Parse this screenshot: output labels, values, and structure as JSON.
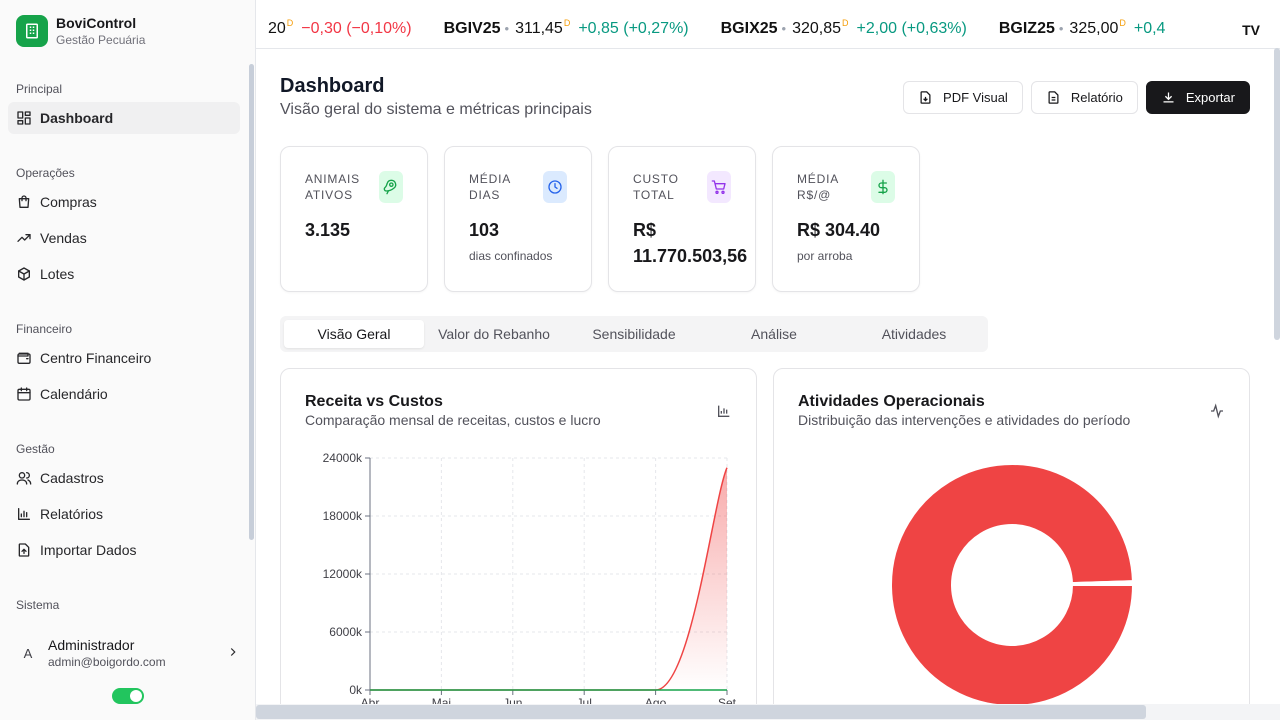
{
  "brand": {
    "name": "BoviControl",
    "subtitle": "Gestão Pecuária"
  },
  "sidebar": {
    "groups": [
      {
        "label": "Principal",
        "items": [
          {
            "label": "Dashboard",
            "icon": "dashboard-icon",
            "active": true
          }
        ]
      },
      {
        "label": "Operações",
        "items": [
          {
            "label": "Compras",
            "icon": "shopping-bag-icon"
          },
          {
            "label": "Vendas",
            "icon": "trending-up-icon"
          },
          {
            "label": "Lotes",
            "icon": "package-icon"
          }
        ]
      },
      {
        "label": "Financeiro",
        "items": [
          {
            "label": "Centro Financeiro",
            "icon": "wallet-icon"
          },
          {
            "label": "Calendário",
            "icon": "calendar-icon"
          }
        ]
      },
      {
        "label": "Gestão",
        "items": [
          {
            "label": "Cadastros",
            "icon": "users-icon"
          },
          {
            "label": "Relatórios",
            "icon": "bar-chart-icon"
          },
          {
            "label": "Importar Dados",
            "icon": "file-upload-icon"
          }
        ]
      },
      {
        "label": "Sistema",
        "items": []
      }
    ],
    "user": {
      "initial": "A",
      "name": "Administrador",
      "email": "admin@boigordo.com"
    }
  },
  "ticker": {
    "items": [
      {
        "symbol": "",
        "price": "20",
        "sup": "D",
        "change": "−0,30 (−0,10%)",
        "trend": "neg"
      },
      {
        "symbol": "BGIV25",
        "price": "311,45",
        "sup": "D",
        "change": "+0,85 (+0,27%)",
        "trend": "pos"
      },
      {
        "symbol": "BGIX25",
        "price": "320,85",
        "sup": "D",
        "change": "+2,00 (+0,63%)",
        "trend": "pos"
      },
      {
        "symbol": "BGIZ25",
        "price": "325,00",
        "sup": "D",
        "change": "+0,4",
        "trend": "pos"
      }
    ],
    "logo": "TV"
  },
  "header": {
    "title": "Dashboard",
    "subtitle": "Visão geral do sistema e métricas principais",
    "actions": {
      "pdf": "PDF Visual",
      "report": "Relatório",
      "export": "Exportar"
    }
  },
  "stats": [
    {
      "label": "Animais Ativos",
      "value": "3.135",
      "sub": "",
      "icon": "beef-icon",
      "color": "#16a34a",
      "bg": "#dcfce7"
    },
    {
      "label": "Média Dias",
      "value": "103",
      "sub": "dias confinados",
      "icon": "clock-icon",
      "color": "#2563eb",
      "bg": "#dbeafe"
    },
    {
      "label": "Custo Total",
      "value": "R$ 11.770.503,56",
      "sub": "",
      "icon": "cart-icon",
      "color": "#9333ea",
      "bg": "#f3e8ff"
    },
    {
      "label": "Média R$/@",
      "value": "R$ 304.40",
      "sub": "por arroba",
      "icon": "dollar-icon",
      "color": "#16a34a",
      "bg": "#dcfce7"
    }
  ],
  "tabs": [
    "Visão Geral",
    "Valor do Rebanho",
    "Sensibilidade",
    "Análise",
    "Atividades"
  ],
  "cards": {
    "revenue": {
      "title": "Receita vs Custos",
      "subtitle": "Comparação mensal de receitas, custos e lucro"
    },
    "activities": {
      "title": "Atividades Operacionais",
      "subtitle": "Distribuição das intervenções e atividades do período"
    }
  },
  "chart_data": [
    {
      "type": "area",
      "x": [
        "Abr",
        "Mai",
        "Jun",
        "Jul",
        "Ago",
        "Set"
      ],
      "yticks": [
        "0k",
        "6000k",
        "12000k",
        "18000k",
        "24000k"
      ],
      "ylim": [
        0,
        24000
      ],
      "series": [
        {
          "values": [
            0,
            0,
            0,
            0,
            0,
            23000
          ],
          "color": "#ef4444"
        },
        {
          "values": [
            0,
            0,
            0,
            0,
            0,
            0
          ],
          "color": "#16a34a"
        }
      ],
      "grid": true
    },
    {
      "type": "pie",
      "slices": [
        {
          "value": 99.5,
          "color": "#ef4444"
        },
        {
          "value": 0.5,
          "color": "#ffffff"
        }
      ]
    }
  ]
}
